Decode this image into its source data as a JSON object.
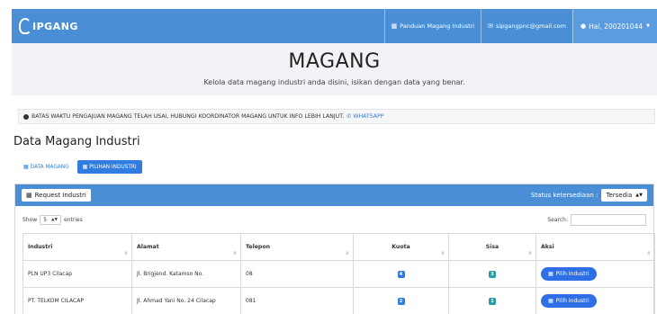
{
  "brand": {
    "name": "IPGANG"
  },
  "navbar": {
    "guide": {
      "icon": "document-icon",
      "label": "Panduan Magang Industri"
    },
    "email": {
      "icon": "envelope-icon",
      "label": "sipgangpnc@gmail.com"
    },
    "user": {
      "icon": "user-icon",
      "label": "Hai, 200201044"
    }
  },
  "hero": {
    "title": "MAGANG",
    "subtitle": "Kelola data magang industri anda disini, isikan dengan data yang benar."
  },
  "alert": {
    "text": "BATAS WAKTU PENGAJUAN MAGANG TELAH USAI, HUBUNGI KOORDINATOR MAGANG UNTUK INFO LEBIH LANJUT.",
    "link": "WHATSAPP"
  },
  "page_title": "Data Magang Industri",
  "tabs": [
    {
      "label": "DATA MAGANG",
      "active": false
    },
    {
      "label": "PILIHAN INDUSTRI",
      "active": true
    }
  ],
  "panel": {
    "request_button": "Request Industri",
    "status_label": "Status ketersediaan :",
    "status_value": "Tersedia"
  },
  "table_controls": {
    "show_label": "Show",
    "length_value": "5",
    "entries_label": "entries",
    "search_label": "Search:",
    "search_value": ""
  },
  "table": {
    "headers": [
      "Industri",
      "Alamat",
      "Telepon",
      "Kuota",
      "Sisa",
      "Aksi"
    ],
    "rows": [
      {
        "industri": "PLN UP3 Cilacap",
        "alamat": "Jl. Brigjend. Katamso No.",
        "telepon": "08",
        "kuota": "4",
        "sisa": "3",
        "aksi": "Pilih Industri"
      },
      {
        "industri": "PT. TELKOM CILACAP",
        "alamat": "Jl. Ahmad Yani No. 24 Cilacap",
        "telepon": "081",
        "kuota": "2",
        "sisa": "1",
        "aksi": "Pilih Industri"
      }
    ]
  },
  "colors": {
    "navbar": "#4a8fd6",
    "primary": "#2f7de1",
    "teal_badge": "#2a9da8",
    "hero_bg": "#f1f3f6"
  }
}
